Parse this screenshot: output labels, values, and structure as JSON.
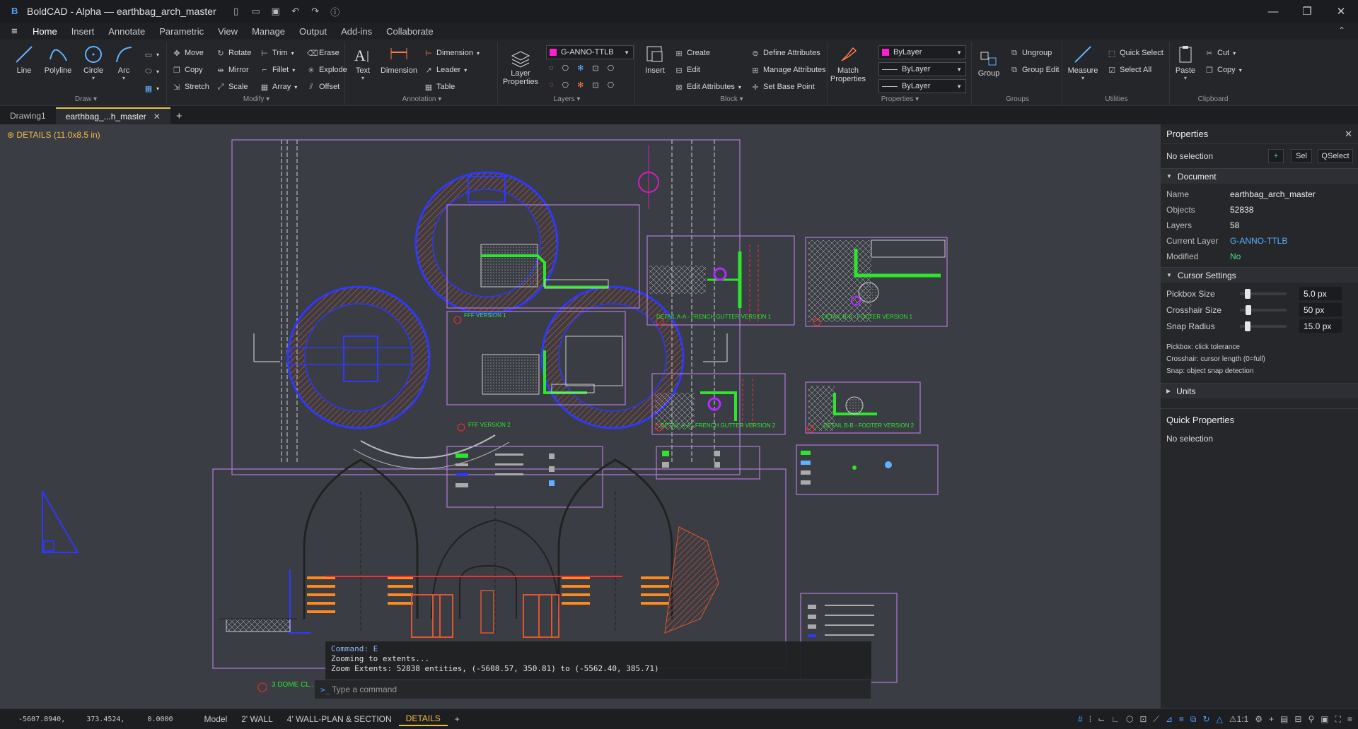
{
  "app": {
    "title": "BoldCAD - Alpha — earthbag_arch_master",
    "logo": "B"
  },
  "ribbon_tabs": [
    "Home",
    "Insert",
    "Annotate",
    "Parametric",
    "View",
    "Manage",
    "Output",
    "Add-ins",
    "Collaborate"
  ],
  "ribbon": {
    "draw": {
      "label": "Draw",
      "line": "Line",
      "polyline": "Polyline",
      "circle": "Circle",
      "arc": "Arc"
    },
    "modify": {
      "label": "Modify",
      "move": "Move",
      "rotate": "Rotate",
      "trim": "Trim",
      "erase": "Erase",
      "copy": "Copy",
      "mirror": "Mirror",
      "fillet": "Fillet",
      "explode": "Explode",
      "stretch": "Stretch",
      "scale": "Scale",
      "array": "Array",
      "offset": "Offset"
    },
    "annotation": {
      "label": "Annotation",
      "text": "Text",
      "dimension_big": "Dimension",
      "dimension": "Dimension",
      "leader": "Leader",
      "table": "Table"
    },
    "layers": {
      "label": "Layers",
      "layer_properties": "Layer Properties",
      "current_layer": "G-ANNO-TTLB"
    },
    "block": {
      "label": "Block",
      "insert": "Insert",
      "create": "Create",
      "edit": "Edit",
      "edit_attributes": "Edit Attributes",
      "define_attributes": "Define Attributes",
      "manage_attributes": "Manage Attributes",
      "set_base_point": "Set Base Point"
    },
    "properties": {
      "label": "Properties",
      "match": "Match Properties",
      "color": "ByLayer",
      "linetype": "ByLayer",
      "lineweight": "ByLayer"
    },
    "groups": {
      "label": "Groups",
      "group": "Group",
      "ungroup": "Ungroup",
      "group_edit": "Group Edit"
    },
    "utilities": {
      "label": "Utilities",
      "measure": "Measure",
      "quick_select": "Quick Select",
      "select_all": "Select All"
    },
    "clipboard": {
      "label": "Clipboard",
      "paste": "Paste",
      "cut": "Cut",
      "copy": "Copy"
    }
  },
  "doc_tabs": [
    "Drawing1",
    "earthbag_...h_master"
  ],
  "canvas": {
    "layout_label": "DETAILS (11.0x8.5 in)",
    "details": [
      "FFF VERSION 1",
      "DETAIL A-A - FRENCH GUTTER VERSION 1",
      "DETAIL B-B - FOOTER VERSION 1",
      "FFF VERSION 2",
      "DETAIL A-A - FRENCH GUTTER VERSION 2",
      "DETAIL B-B - FOOTER VERSION 2",
      "3 DOME CL..."
    ]
  },
  "command": {
    "history": [
      "Command: E",
      "Zooming to extents...",
      "Zoom Extents: 52838 entities, (-5608.57, 350.81) to (-5562.40, 385.71)"
    ],
    "placeholder": "Type a command"
  },
  "properties_panel": {
    "title": "Properties",
    "selection": "No selection",
    "btn_add": "+",
    "btn_sel": "Sel",
    "btn_qselect": "QSelect",
    "document": {
      "section": "Document",
      "rows": [
        {
          "k": "Name",
          "v": "earthbag_arch_master"
        },
        {
          "k": "Objects",
          "v": "52838"
        },
        {
          "k": "Layers",
          "v": "58"
        },
        {
          "k": "Current Layer",
          "v": "G-ANNO-TTLB"
        },
        {
          "k": "Modified",
          "v": "No"
        }
      ]
    },
    "cursor": {
      "section": "Cursor Settings",
      "pickbox": {
        "label": "Pickbox Size",
        "value": "5.0 px",
        "level": 0.1
      },
      "crosshair": {
        "label": "Crosshair Size",
        "value": "50 px",
        "level": 0.12
      },
      "snap": {
        "label": "Snap Radius",
        "value": "15.0 px",
        "level": 0.1
      },
      "hints": [
        "Pickbox: click tolerance",
        "Crosshair: cursor length (0=full)",
        "Snap: object snap detection"
      ]
    },
    "units": "Units",
    "quick_props": {
      "title": "Quick Properties",
      "selection": "No selection"
    }
  },
  "status": {
    "x": "-5607.8940,",
    "y": "373.4524,",
    "z": "0.0000",
    "layout_tabs": [
      "Model",
      "2' WALL",
      "4' WALL-PLAN & SECTION",
      "DETAILS"
    ],
    "active_layout": "DETAILS",
    "scale": "1:1"
  },
  "colors": {
    "accent": "#4da3ff",
    "active_tab": "#f0c040",
    "layer_swatch": "#ff1fd1",
    "detail_frame": "#b27bd6"
  }
}
